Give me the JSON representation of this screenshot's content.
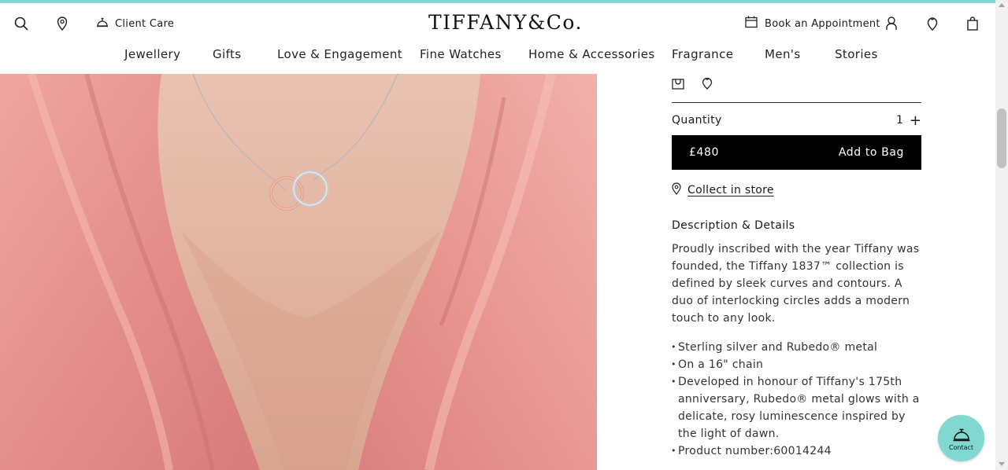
{
  "header": {
    "client_care": "Client Care",
    "logo": "TIFFANY&Co.",
    "appointment": "Book an Appointment",
    "icons": [
      "search-icon",
      "location-pin-icon",
      "client-care-icon",
      "calendar-icon",
      "account-icon",
      "wishlist-icon",
      "shopping-bag-icon"
    ]
  },
  "nav": {
    "items": [
      "Jewellery",
      "Gifts",
      "Love & Engagement",
      "Fine Watches",
      "Home & Accessories",
      "Fragrance",
      "Men's",
      "Stories"
    ]
  },
  "product": {
    "quantity_label": "Quantity",
    "quantity_value": "1",
    "quantity_plus": "+",
    "price": "£480",
    "add_to_bag": "Add to Bag",
    "collect_in_store": "Collect in store",
    "description_title": "Description & Details",
    "description": "Proudly inscribed with the year Tiffany was founded, the Tiffany 1837™ collection is defined by sleek curves and contours. A duo of interlocking circles adds a modern touch to any look.",
    "details": [
      "Sterling silver and Rubedo® metal",
      "On a 16\" chain",
      "Developed in honour of Tiffany's 175th anniversary, Rubedo® metal glows with a delicate, rosy luminescence inspired by the light of dawn.",
      "Product number:60014244"
    ]
  },
  "contact": {
    "label": "Contact"
  },
  "colors": {
    "brand_blue": "#81d8d0",
    "button_black": "#000000"
  }
}
